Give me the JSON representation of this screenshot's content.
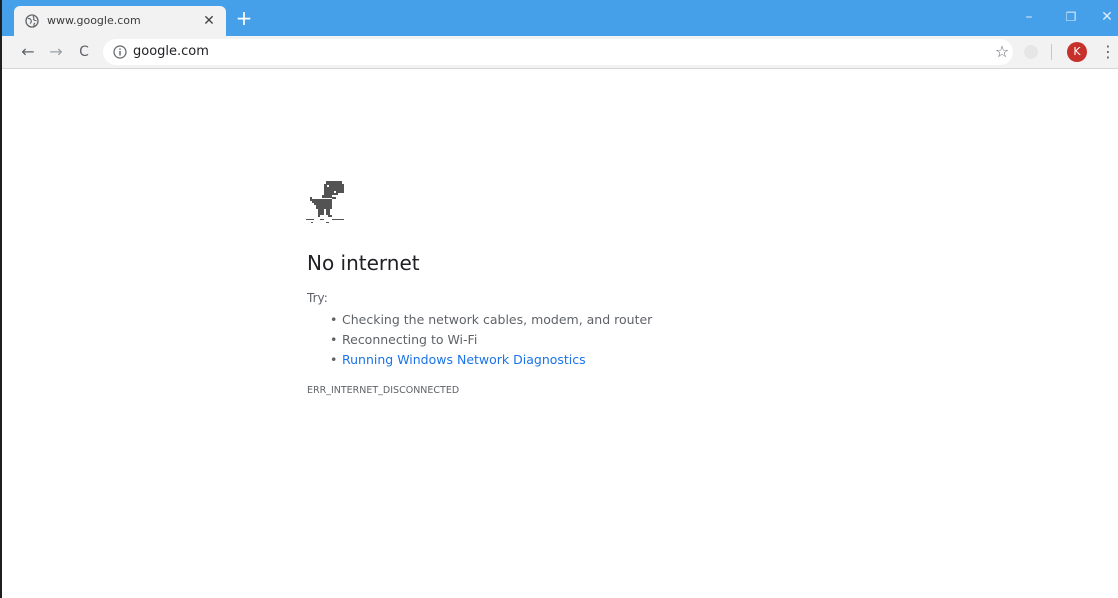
{
  "colors": {
    "tabbar": "#46a0e9",
    "toolbar": "#f2f2f2",
    "avatar": "#c6322b",
    "link": "#1a73e8"
  },
  "tab": {
    "title": "www.google.com",
    "favicon": "globe-icon",
    "close_label": "✕"
  },
  "newtab_label": "+",
  "window_controls": {
    "minimize": "–",
    "restore": "❐",
    "close": "✕"
  },
  "toolbar": {
    "back": "←",
    "forward": "→",
    "reload": "C",
    "url": "google.com",
    "star": "☆",
    "avatar_initial": "K",
    "menu": "⋮"
  },
  "error_page": {
    "headline": "No internet",
    "try_label": "Try:",
    "suggestions": [
      "Checking the network cables, modem, and router",
      "Reconnecting to Wi-Fi",
      "Running Windows Network Diagnostics"
    ],
    "error_code": "ERR_INTERNET_DISCONNECTED"
  }
}
